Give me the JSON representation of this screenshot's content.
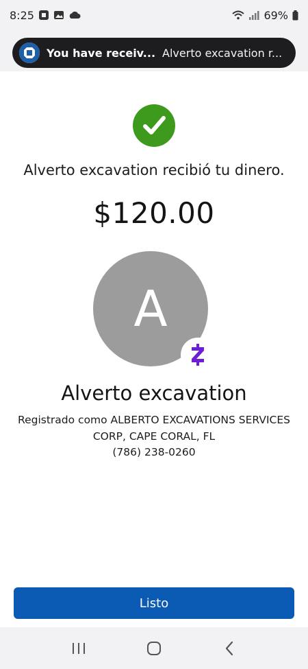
{
  "status_bar": {
    "time": "8:25",
    "battery": "69%"
  },
  "notification": {
    "title": "You have receiv...",
    "body": "Alverto excavation r..."
  },
  "confirmation": {
    "message": "Alverto excavation recibió tu dinero.",
    "amount": "$120.00"
  },
  "recipient": {
    "avatar_initial": "A",
    "name": "Alverto excavation",
    "registered_as": "Registrado como ALBERTO EXCAVATIONS SERVICES CORP, CAPE CORAL, FL",
    "phone": "(786) 238-0260"
  },
  "actions": {
    "done_label": "Listo"
  },
  "colors": {
    "check_green": "#3e9a1c",
    "button_blue": "#0b5bb5",
    "zelle_purple": "#6d1ed4",
    "avatar_gray": "#9c9c9c"
  },
  "icons": {
    "status": [
      "chase-icon",
      "gallery-icon",
      "cloud-icon",
      "wifi-icon",
      "signal-icon",
      "battery-icon"
    ],
    "nav": [
      "recents-icon",
      "home-icon",
      "back-icon"
    ]
  }
}
